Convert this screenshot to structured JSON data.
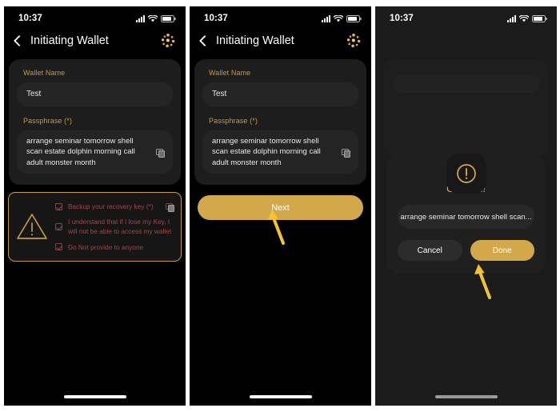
{
  "colors": {
    "gold": "#d3a84a",
    "gold_label": "#c79a3e",
    "danger_red": "#a64545",
    "screen_bg": "#000000",
    "card_bg": "#1d1d1d",
    "input_bg": "#242424",
    "dim_overlay": "#1b1b1b",
    "arrow": "#f5c32c"
  },
  "status_bar": {
    "time": "10:37",
    "signal_icon": "cellular-signal-icon",
    "wifi_icon": "wifi-icon",
    "battery_icon": "battery-icon"
  },
  "nav": {
    "back_icon": "back-chevron-icon",
    "title": "Initiating Wallet",
    "brand_icon": "wallet-dots-logo-icon"
  },
  "form": {
    "wallet_name_label": "Wallet Name",
    "wallet_name_value": "Test",
    "wallet_name_placeholder": "Wallet Name",
    "passphrase_label": "Passphrase (*)",
    "passphrase_value": "arrange seminar tomorrow shell scan estate dolphin morning call adult monster month",
    "passphrase_placeholder": "Passphrase",
    "copy_icon": "copy-icon"
  },
  "warning": {
    "warning_icon": "warning-triangle-icon",
    "items": [
      {
        "label": "Backup your recovery key (*)",
        "checkbox_icon": "checkbox-checked-icon",
        "has_copy": true
      },
      {
        "label": "I understand that if I lose my Key, I will not be able to access my wallet",
        "checkbox_icon": "checkbox-checked-icon",
        "has_copy": false
      },
      {
        "label": "Do Not provide to anyone",
        "checkbox_icon": "checkbox-checked-icon",
        "has_copy": false
      }
    ]
  },
  "panel2": {
    "next_label": "Next",
    "arrow_icon": "annotation-arrow-icon"
  },
  "modal": {
    "badge_icon": "exclamation-circle-icon",
    "title": "Confirm!",
    "input_value": "arrange seminar tomorrow shell scan...",
    "cancel_label": "Cancel",
    "done_label": "Done",
    "arrow_icon": "annotation-arrow-icon"
  }
}
